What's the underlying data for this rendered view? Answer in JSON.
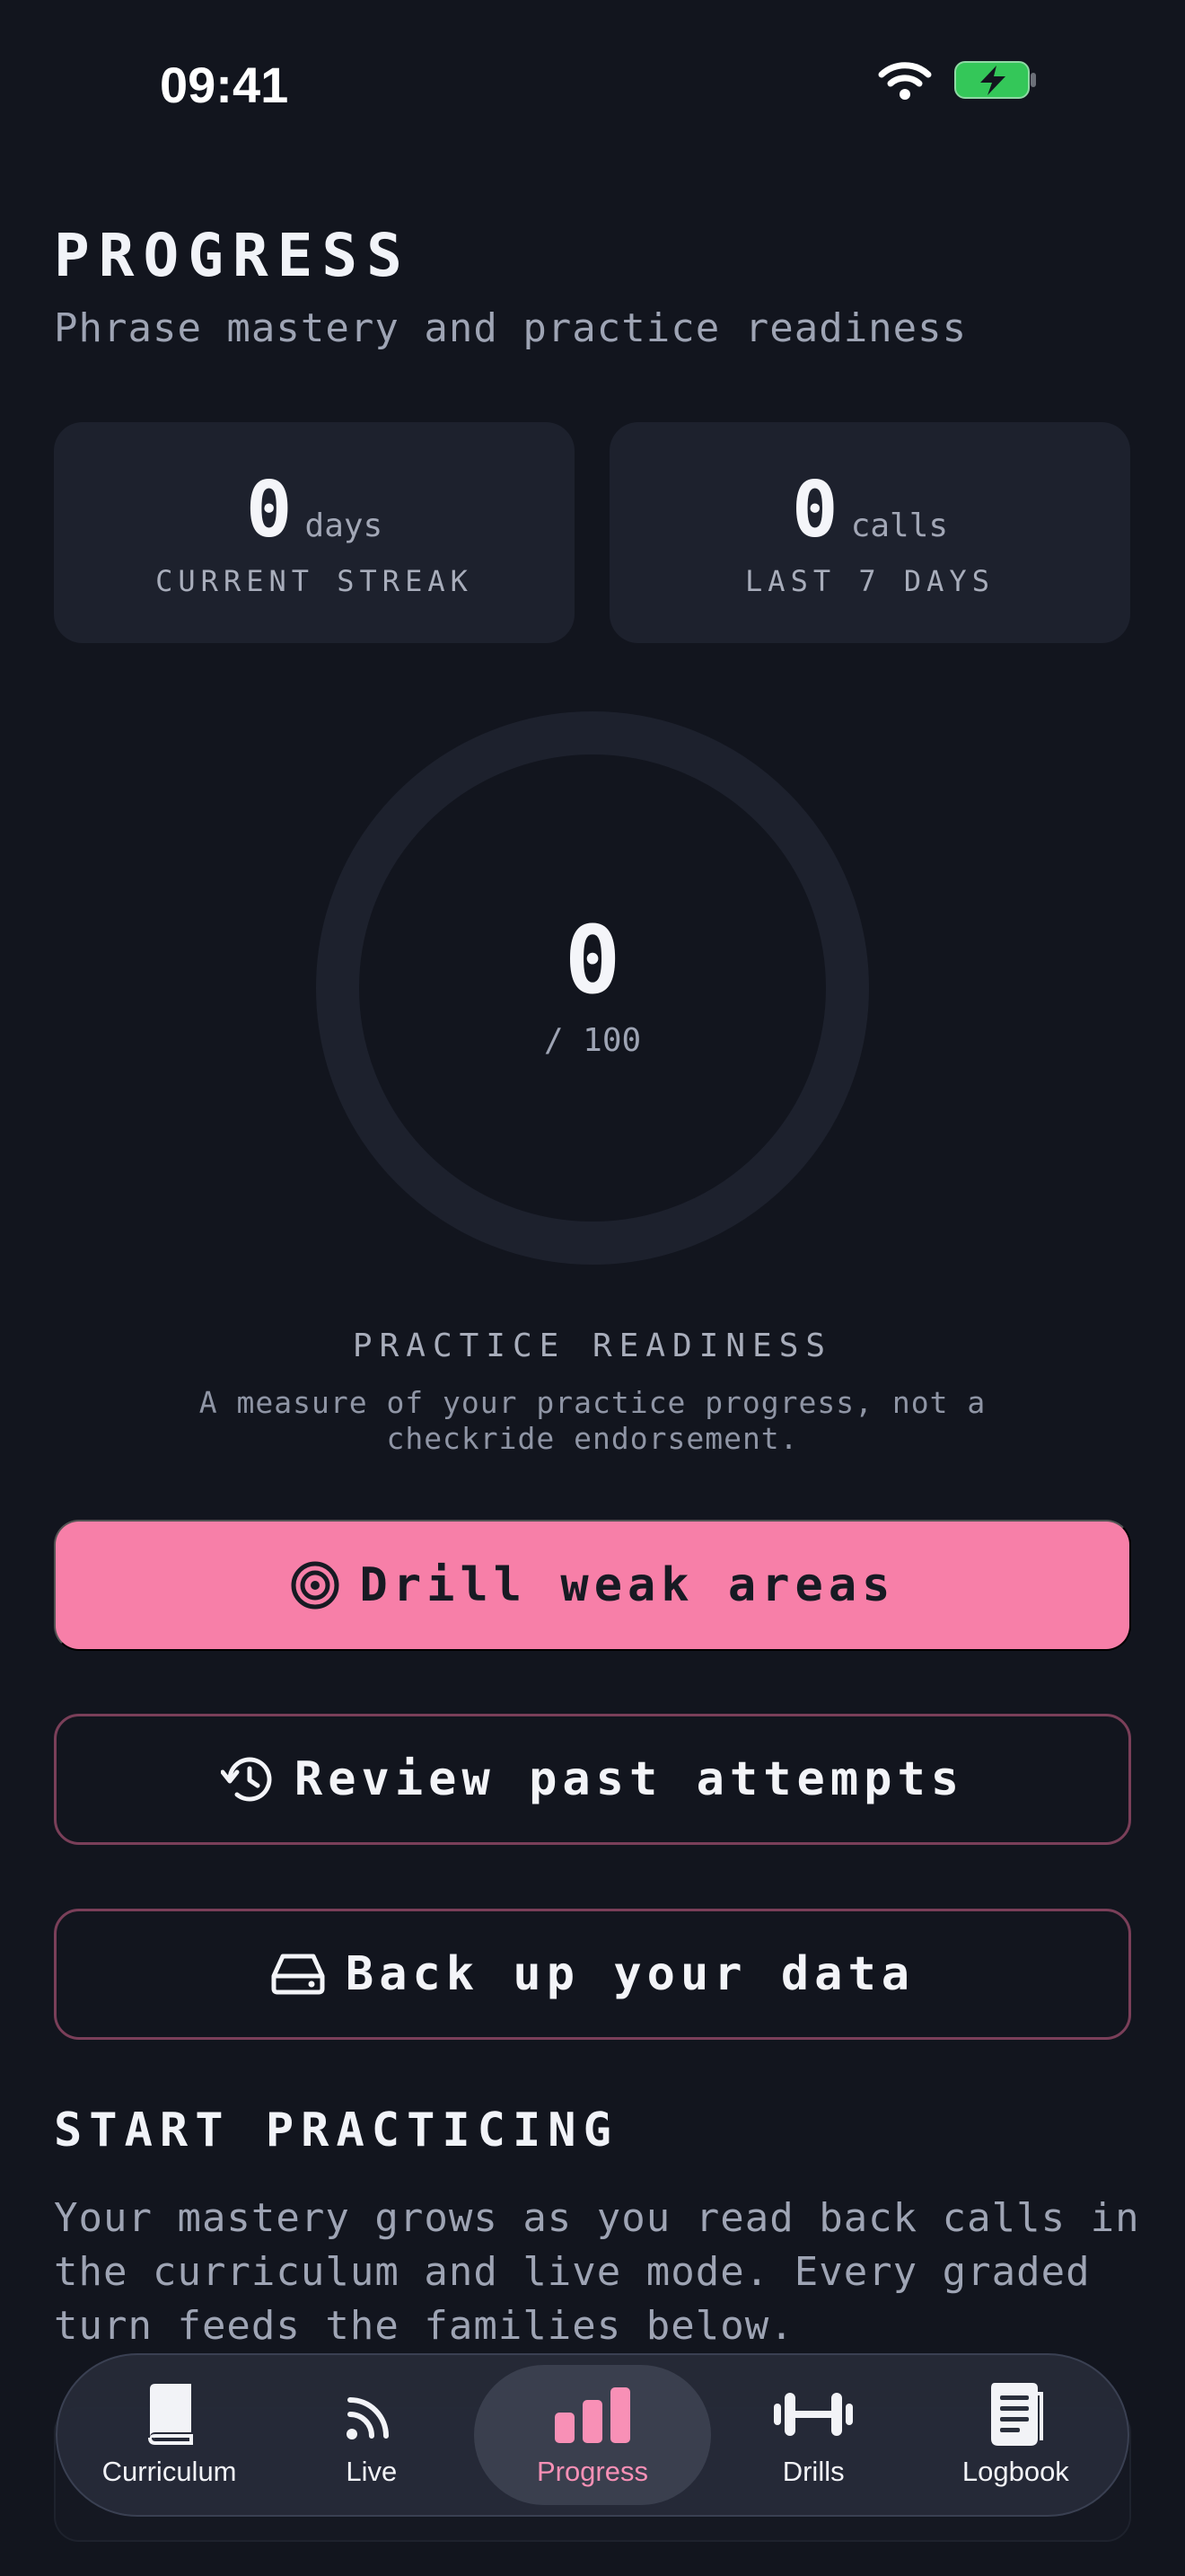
{
  "status_bar": {
    "time": "09:41"
  },
  "header": {
    "title": "PROGRESS",
    "subtitle": "Phrase mastery and practice readiness"
  },
  "stats": [
    {
      "value": "0",
      "unit": "days",
      "label": "CURRENT STREAK"
    },
    {
      "value": "0",
      "unit": "calls",
      "label": "LAST 7 DAYS"
    }
  ],
  "readiness": {
    "score": "0",
    "max": "/ 100",
    "score_fraction": 0,
    "title": "PRACTICE READINESS",
    "note": "A measure of your practice progress, not a checkride endorsement."
  },
  "actions": {
    "drill_label": "Drill weak areas",
    "review_label": "Review past attempts",
    "backup_label": "Back up your data"
  },
  "start_practicing": {
    "title": "START PRACTICING",
    "body": "Your mastery grows as you read back calls in the curriculum and live mode. Every graded turn feeds the families below."
  },
  "tabs": [
    {
      "label": "Curriculum",
      "icon": "book-icon"
    },
    {
      "label": "Live",
      "icon": "signal-icon"
    },
    {
      "label": "Progress",
      "icon": "bar-chart-icon",
      "active": true
    },
    {
      "label": "Drills",
      "icon": "dumbbell-icon"
    },
    {
      "label": "Logbook",
      "icon": "document-icon"
    }
  ],
  "colors": {
    "background": "#12151e",
    "card": "#1d212d",
    "accent": "#f77fa8",
    "outline": "#7a3f59",
    "battery": "#34c759"
  }
}
